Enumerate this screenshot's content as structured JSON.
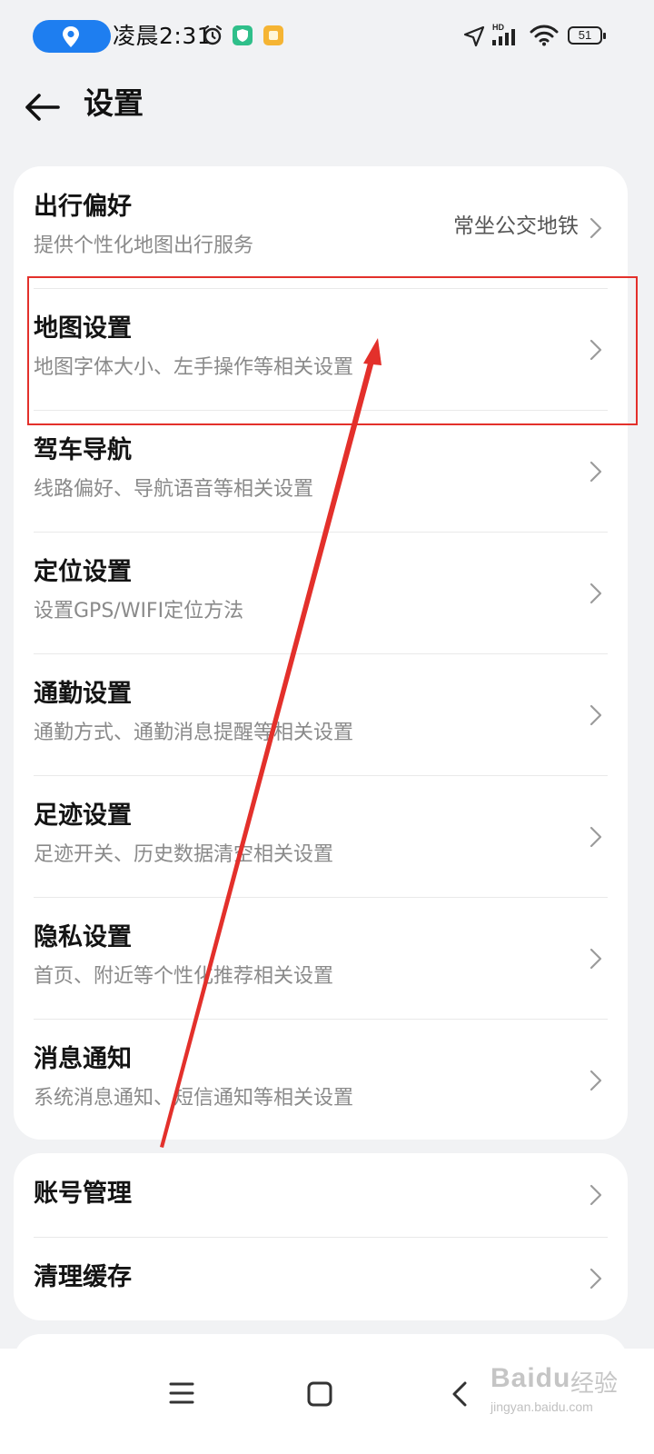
{
  "status_bar": {
    "time": "凌晨2:31",
    "battery": "51",
    "network_label": "HD",
    "icons": [
      "location-pill-icon",
      "alarm-icon",
      "shield-app-icon",
      "yellow-app-icon",
      "navigation-icon",
      "signal-icon",
      "wifi-icon",
      "battery-icon"
    ]
  },
  "header": {
    "back_icon": "arrow-left-icon",
    "title": "设置"
  },
  "settings_main": [
    {
      "title": "出行偏好",
      "subtitle": "提供个性化地图出行服务",
      "value": "常坐公交地铁"
    },
    {
      "title": "地图设置",
      "subtitle": "地图字体大小、左手操作等相关设置"
    },
    {
      "title": "驾车导航",
      "subtitle": "线路偏好、导航语音等相关设置"
    },
    {
      "title": "定位设置",
      "subtitle": "设置GPS/WIFI定位方法"
    },
    {
      "title": "通勤设置",
      "subtitle": "通勤方式、通勤消息提醒等相关设置"
    },
    {
      "title": "足迹设置",
      "subtitle": "足迹开关、历史数据清空相关设置"
    },
    {
      "title": "隐私设置",
      "subtitle": "首页、附近等个性化推荐相关设置"
    },
    {
      "title": "消息通知",
      "subtitle": "系统消息通知、短信通知等相关设置"
    }
  ],
  "settings_account": [
    {
      "title": "账号管理"
    },
    {
      "title": "清理缓存"
    }
  ],
  "annotation": {
    "highlighted_item": "地图设置",
    "color": "#e3302b"
  },
  "nav_bar": {
    "icons": [
      "menu-icon",
      "home-icon",
      "back-icon"
    ]
  },
  "watermark": {
    "main": "Baidu",
    "cn": "经验",
    "sub": "jingyan.baidu.com"
  },
  "colors": {
    "background": "#f1f2f4",
    "card": "#ffffff",
    "accent": "#1e7ef0",
    "subtitle": "#8a8a8a"
  }
}
